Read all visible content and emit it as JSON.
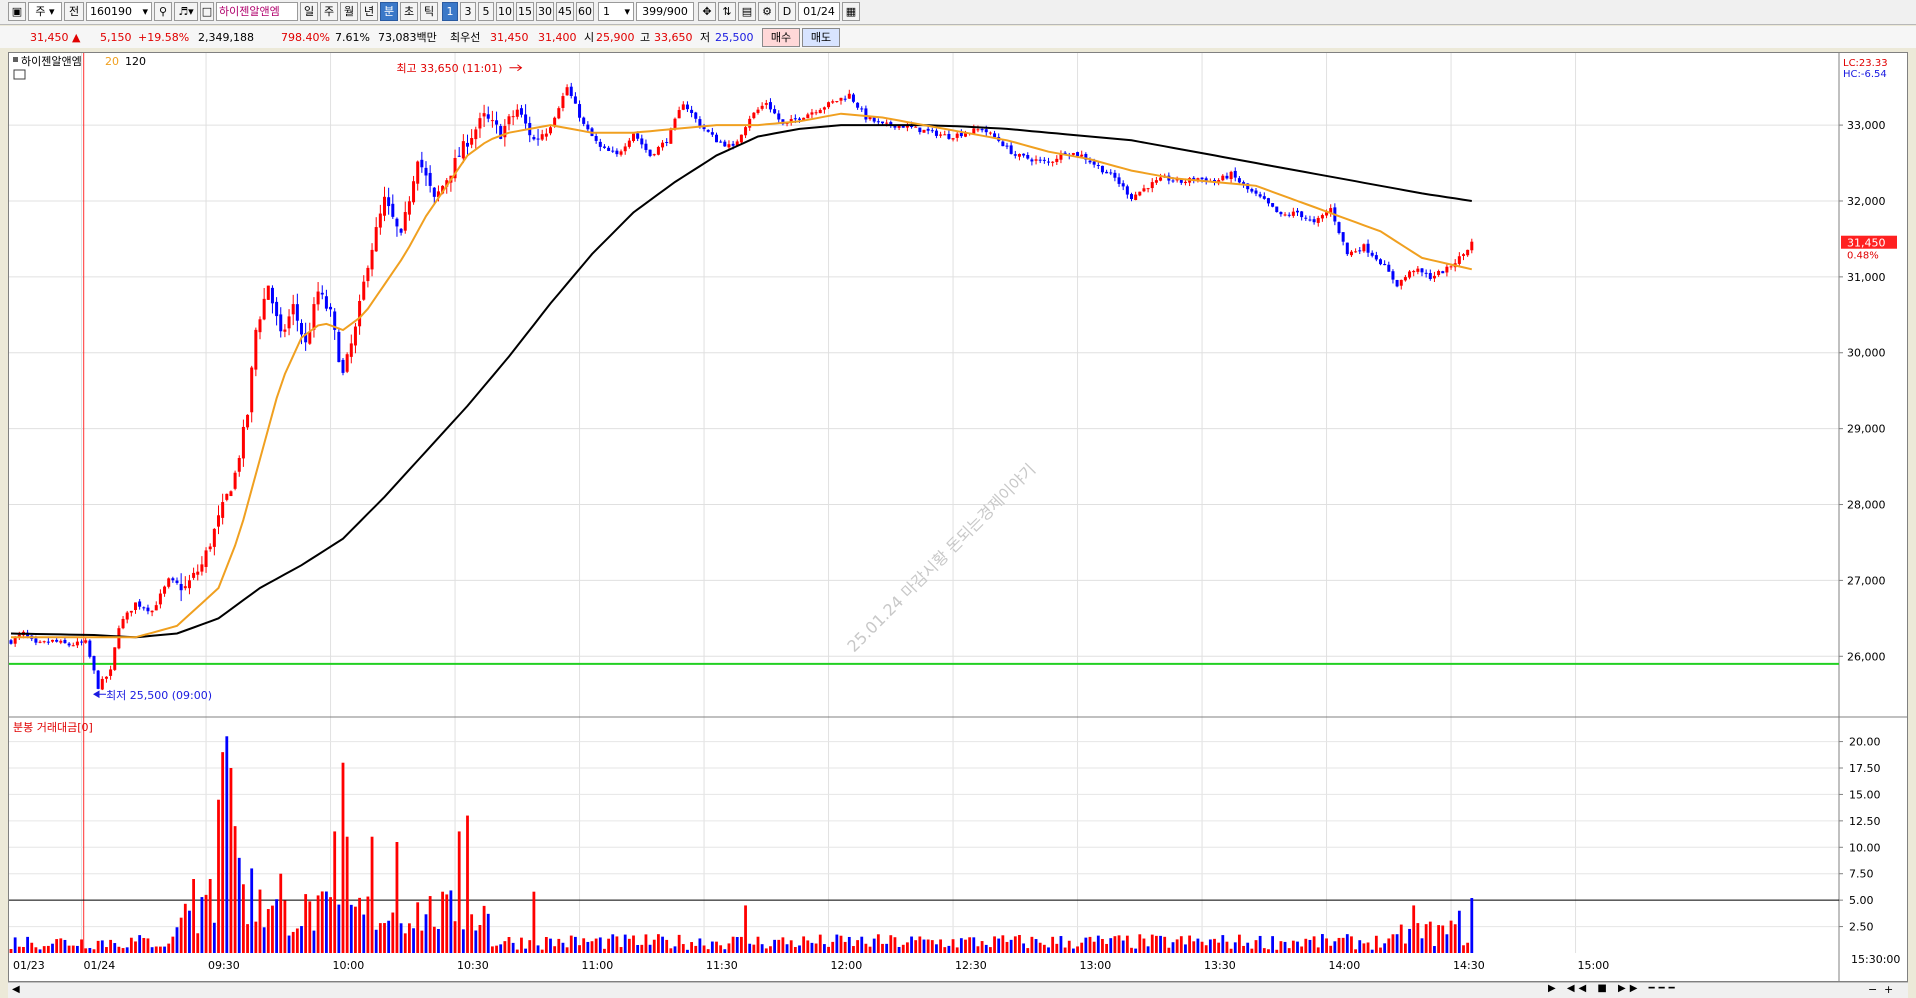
{
  "toolbar": {
    "market_label": "주",
    "prev_label": "전",
    "code_value": "160190",
    "stock_name": "하이젠알앤엠",
    "period_buttons": [
      "일",
      "주",
      "월",
      "년",
      "분",
      "초",
      "틱"
    ],
    "selected_period": "분",
    "interval_buttons": [
      "1",
      "3",
      "5",
      "10",
      "15",
      "30",
      "45",
      "60"
    ],
    "selected_interval": "1",
    "interval_select": "1",
    "count_value": "399/900",
    "d_label": "D",
    "date_value": "01/24"
  },
  "quote": {
    "price": "31,450",
    "up_arrow": "▲",
    "change": "5,150",
    "change_rate": "+19.58%",
    "volume": "2,349,188",
    "volume_rate": "798.40%",
    "turnover": "7.61%",
    "amount": "73,083백만",
    "priority_label": "최우선",
    "ask": "31,450",
    "bid": "31,400",
    "open_label": "시",
    "open": "25,900",
    "high_label": "고",
    "high": "33,650",
    "low_label": "저",
    "low": "25,500",
    "buy_button": "매수",
    "sell_button": "매도"
  },
  "legend": {
    "name": "하이젠알앤엠",
    "ma_short": "20",
    "ma_long": "120",
    "volume_title": "분봉 거래대금[0]"
  },
  "annotations": {
    "high_marker": "최고 33,650 (11:01)",
    "low_marker": "최저 25,500 (09:00)",
    "lc": "LC:23.33",
    "hc": "HC:-6.54",
    "current_price_tag": "31,450",
    "current_rate_tag": "0.48%",
    "watermark": "25.01.24 마감시황 돈되는경제이야기",
    "time_end": "15:30:00"
  },
  "colors": {
    "up": "#ff0000",
    "down": "#0000ff",
    "ma20": "#f0a020",
    "ma120": "#000000",
    "support_line": "#22d022",
    "background": "#ffffff"
  },
  "chart_data": [
    {
      "type": "candlestick",
      "title": "하이젠알앤엠",
      "x_tick_labels": [
        "01/23",
        "01/24",
        "09:30",
        "10:00",
        "10:30",
        "11:00",
        "11:30",
        "12:00",
        "12:30",
        "13:00",
        "13:30",
        "14:00",
        "14:30",
        "15:00"
      ],
      "ylim": [
        25200,
        33950
      ],
      "y_tick_labels": [
        "33,000",
        "32,000",
        "31,000",
        "30,000",
        "29,000",
        "28,000",
        "27,000",
        "26,000"
      ],
      "series": [
        {
          "name": "20",
          "type": "line"
        },
        {
          "name": "120",
          "type": "line"
        }
      ],
      "close_path": [
        [
          0,
          26200
        ],
        [
          3,
          26300
        ],
        [
          6,
          26150
        ],
        [
          10,
          26200
        ],
        [
          14,
          26150
        ],
        [
          18,
          26180
        ],
        [
          21,
          25600
        ],
        [
          24,
          25800
        ],
        [
          26,
          26400
        ],
        [
          30,
          26700
        ],
        [
          34,
          26600
        ],
        [
          38,
          27000
        ],
        [
          42,
          26900
        ],
        [
          46,
          27200
        ],
        [
          50,
          27800
        ],
        [
          54,
          28400
        ],
        [
          57,
          29200
        ],
        [
          59,
          30300
        ],
        [
          62,
          30900
        ],
        [
          65,
          30200
        ],
        [
          68,
          30600
        ],
        [
          71,
          30100
        ],
        [
          74,
          30800
        ],
        [
          77,
          30500
        ],
        [
          80,
          29700
        ],
        [
          83,
          30300
        ],
        [
          86,
          31200
        ],
        [
          90,
          32000
        ],
        [
          94,
          31500
        ],
        [
          98,
          32600
        ],
        [
          102,
          32000
        ],
        [
          106,
          32400
        ],
        [
          110,
          32800
        ],
        [
          114,
          33100
        ],
        [
          118,
          32900
        ],
        [
          122,
          33200
        ],
        [
          126,
          32800
        ],
        [
          130,
          33000
        ],
        [
          134,
          33500
        ],
        [
          138,
          33000
        ],
        [
          142,
          32700
        ],
        [
          146,
          32600
        ],
        [
          150,
          32900
        ],
        [
          154,
          32600
        ],
        [
          158,
          32800
        ],
        [
          162,
          33300
        ],
        [
          166,
          33000
        ],
        [
          170,
          32800
        ],
        [
          174,
          32700
        ],
        [
          178,
          33100
        ],
        [
          182,
          33300
        ],
        [
          186,
          33000
        ],
        [
          190,
          33100
        ],
        [
          194,
          33200
        ],
        [
          198,
          33300
        ],
        [
          202,
          33400
        ],
        [
          206,
          33100
        ],
        [
          210,
          33000
        ],
        [
          214,
          33000
        ],
        [
          218,
          32950
        ],
        [
          222,
          32900
        ],
        [
          226,
          32850
        ],
        [
          230,
          32900
        ],
        [
          234,
          32950
        ],
        [
          238,
          32800
        ],
        [
          242,
          32600
        ],
        [
          246,
          32550
        ],
        [
          250,
          32500
        ],
        [
          254,
          32650
        ],
        [
          258,
          32600
        ],
        [
          262,
          32450
        ],
        [
          266,
          32300
        ],
        [
          270,
          32050
        ],
        [
          274,
          32200
        ],
        [
          278,
          32300
        ],
        [
          282,
          32250
        ],
        [
          286,
          32300
        ],
        [
          290,
          32250
        ],
        [
          294,
          32350
        ],
        [
          298,
          32150
        ],
        [
          302,
          32000
        ],
        [
          306,
          31800
        ],
        [
          310,
          31850
        ],
        [
          314,
          31700
        ],
        [
          318,
          31900
        ],
        [
          322,
          31300
        ],
        [
          326,
          31400
        ],
        [
          330,
          31200
        ],
        [
          334,
          30900
        ],
        [
          338,
          31100
        ],
        [
          342,
          31000
        ],
        [
          346,
          31100
        ],
        [
          350,
          31300
        ],
        [
          352,
          31450
        ]
      ],
      "ma20_path": [
        [
          0,
          26250
        ],
        [
          20,
          26250
        ],
        [
          30,
          26250
        ],
        [
          40,
          26400
        ],
        [
          50,
          26900
        ],
        [
          55,
          27600
        ],
        [
          60,
          28600
        ],
        [
          65,
          29600
        ],
        [
          70,
          30200
        ],
        [
          75,
          30400
        ],
        [
          80,
          30300
        ],
        [
          85,
          30500
        ],
        [
          90,
          30900
        ],
        [
          95,
          31300
        ],
        [
          100,
          31800
        ],
        [
          105,
          32200
        ],
        [
          110,
          32600
        ],
        [
          115,
          32800
        ],
        [
          120,
          32900
        ],
        [
          130,
          33000
        ],
        [
          140,
          32900
        ],
        [
          150,
          32900
        ],
        [
          160,
          32950
        ],
        [
          170,
          33000
        ],
        [
          180,
          33000
        ],
        [
          190,
          33050
        ],
        [
          200,
          33150
        ],
        [
          210,
          33100
        ],
        [
          220,
          33000
        ],
        [
          230,
          32900
        ],
        [
          240,
          32800
        ],
        [
          250,
          32650
        ],
        [
          260,
          32550
        ],
        [
          270,
          32400
        ],
        [
          280,
          32300
        ],
        [
          290,
          32250
        ],
        [
          300,
          32200
        ],
        [
          310,
          32000
        ],
        [
          320,
          31800
        ],
        [
          330,
          31600
        ],
        [
          340,
          31250
        ],
        [
          352,
          31100
        ]
      ],
      "ma120_path": [
        [
          0,
          26300
        ],
        [
          20,
          26280
        ],
        [
          30,
          26250
        ],
        [
          40,
          26300
        ],
        [
          50,
          26500
        ],
        [
          60,
          26900
        ],
        [
          70,
          27200
        ],
        [
          80,
          27550
        ],
        [
          90,
          28100
        ],
        [
          100,
          28700
        ],
        [
          110,
          29300
        ],
        [
          120,
          29950
        ],
        [
          130,
          30650
        ],
        [
          140,
          31300
        ],
        [
          150,
          31850
        ],
        [
          160,
          32250
        ],
        [
          170,
          32600
        ],
        [
          180,
          32850
        ],
        [
          190,
          32950
        ],
        [
          200,
          33000
        ],
        [
          210,
          33000
        ],
        [
          220,
          33000
        ],
        [
          230,
          32980
        ],
        [
          240,
          32950
        ],
        [
          250,
          32900
        ],
        [
          260,
          32850
        ],
        [
          270,
          32800
        ],
        [
          280,
          32700
        ],
        [
          290,
          32600
        ],
        [
          300,
          32500
        ],
        [
          310,
          32400
        ],
        [
          320,
          32300
        ],
        [
          330,
          32200
        ],
        [
          340,
          32100
        ],
        [
          352,
          32000
        ]
      ]
    },
    {
      "type": "bar",
      "title": "분봉 거래대금[0]",
      "ylim": [
        0,
        21
      ],
      "y_tick_labels": [
        "20.00",
        "17.50",
        "15.00",
        "12.50",
        "10.00",
        "7.50",
        "5.00",
        "2.50"
      ],
      "reference_line": 5.0,
      "peaks": [
        {
          "bar": 44,
          "value": 7.0
        },
        {
          "bar": 47,
          "value": 5.5
        },
        {
          "bar": 48,
          "value": 7.0
        },
        {
          "bar": 50,
          "value": 14.5
        },
        {
          "bar": 51,
          "value": 19.0
        },
        {
          "bar": 52,
          "value": 20.5
        },
        {
          "bar": 53,
          "value": 17.5
        },
        {
          "bar": 54,
          "value": 12.0
        },
        {
          "bar": 55,
          "value": 9.0
        },
        {
          "bar": 56,
          "value": 6.5
        },
        {
          "bar": 58,
          "value": 8.0
        },
        {
          "bar": 60,
          "value": 6.0
        },
        {
          "bar": 65,
          "value": 7.5
        },
        {
          "bar": 78,
          "value": 11.5
        },
        {
          "bar": 80,
          "value": 18.0
        },
        {
          "bar": 81,
          "value": 11.0
        },
        {
          "bar": 87,
          "value": 11.0
        },
        {
          "bar": 93,
          "value": 10.5
        },
        {
          "bar": 108,
          "value": 11.5
        },
        {
          "bar": 110,
          "value": 13.0
        },
        {
          "bar": 126,
          "value": 5.8
        },
        {
          "bar": 177,
          "value": 4.5
        },
        {
          "bar": 338,
          "value": 4.5
        },
        {
          "bar": 349,
          "value": 4.0
        },
        {
          "bar": 352,
          "value": 5.2
        }
      ]
    }
  ]
}
